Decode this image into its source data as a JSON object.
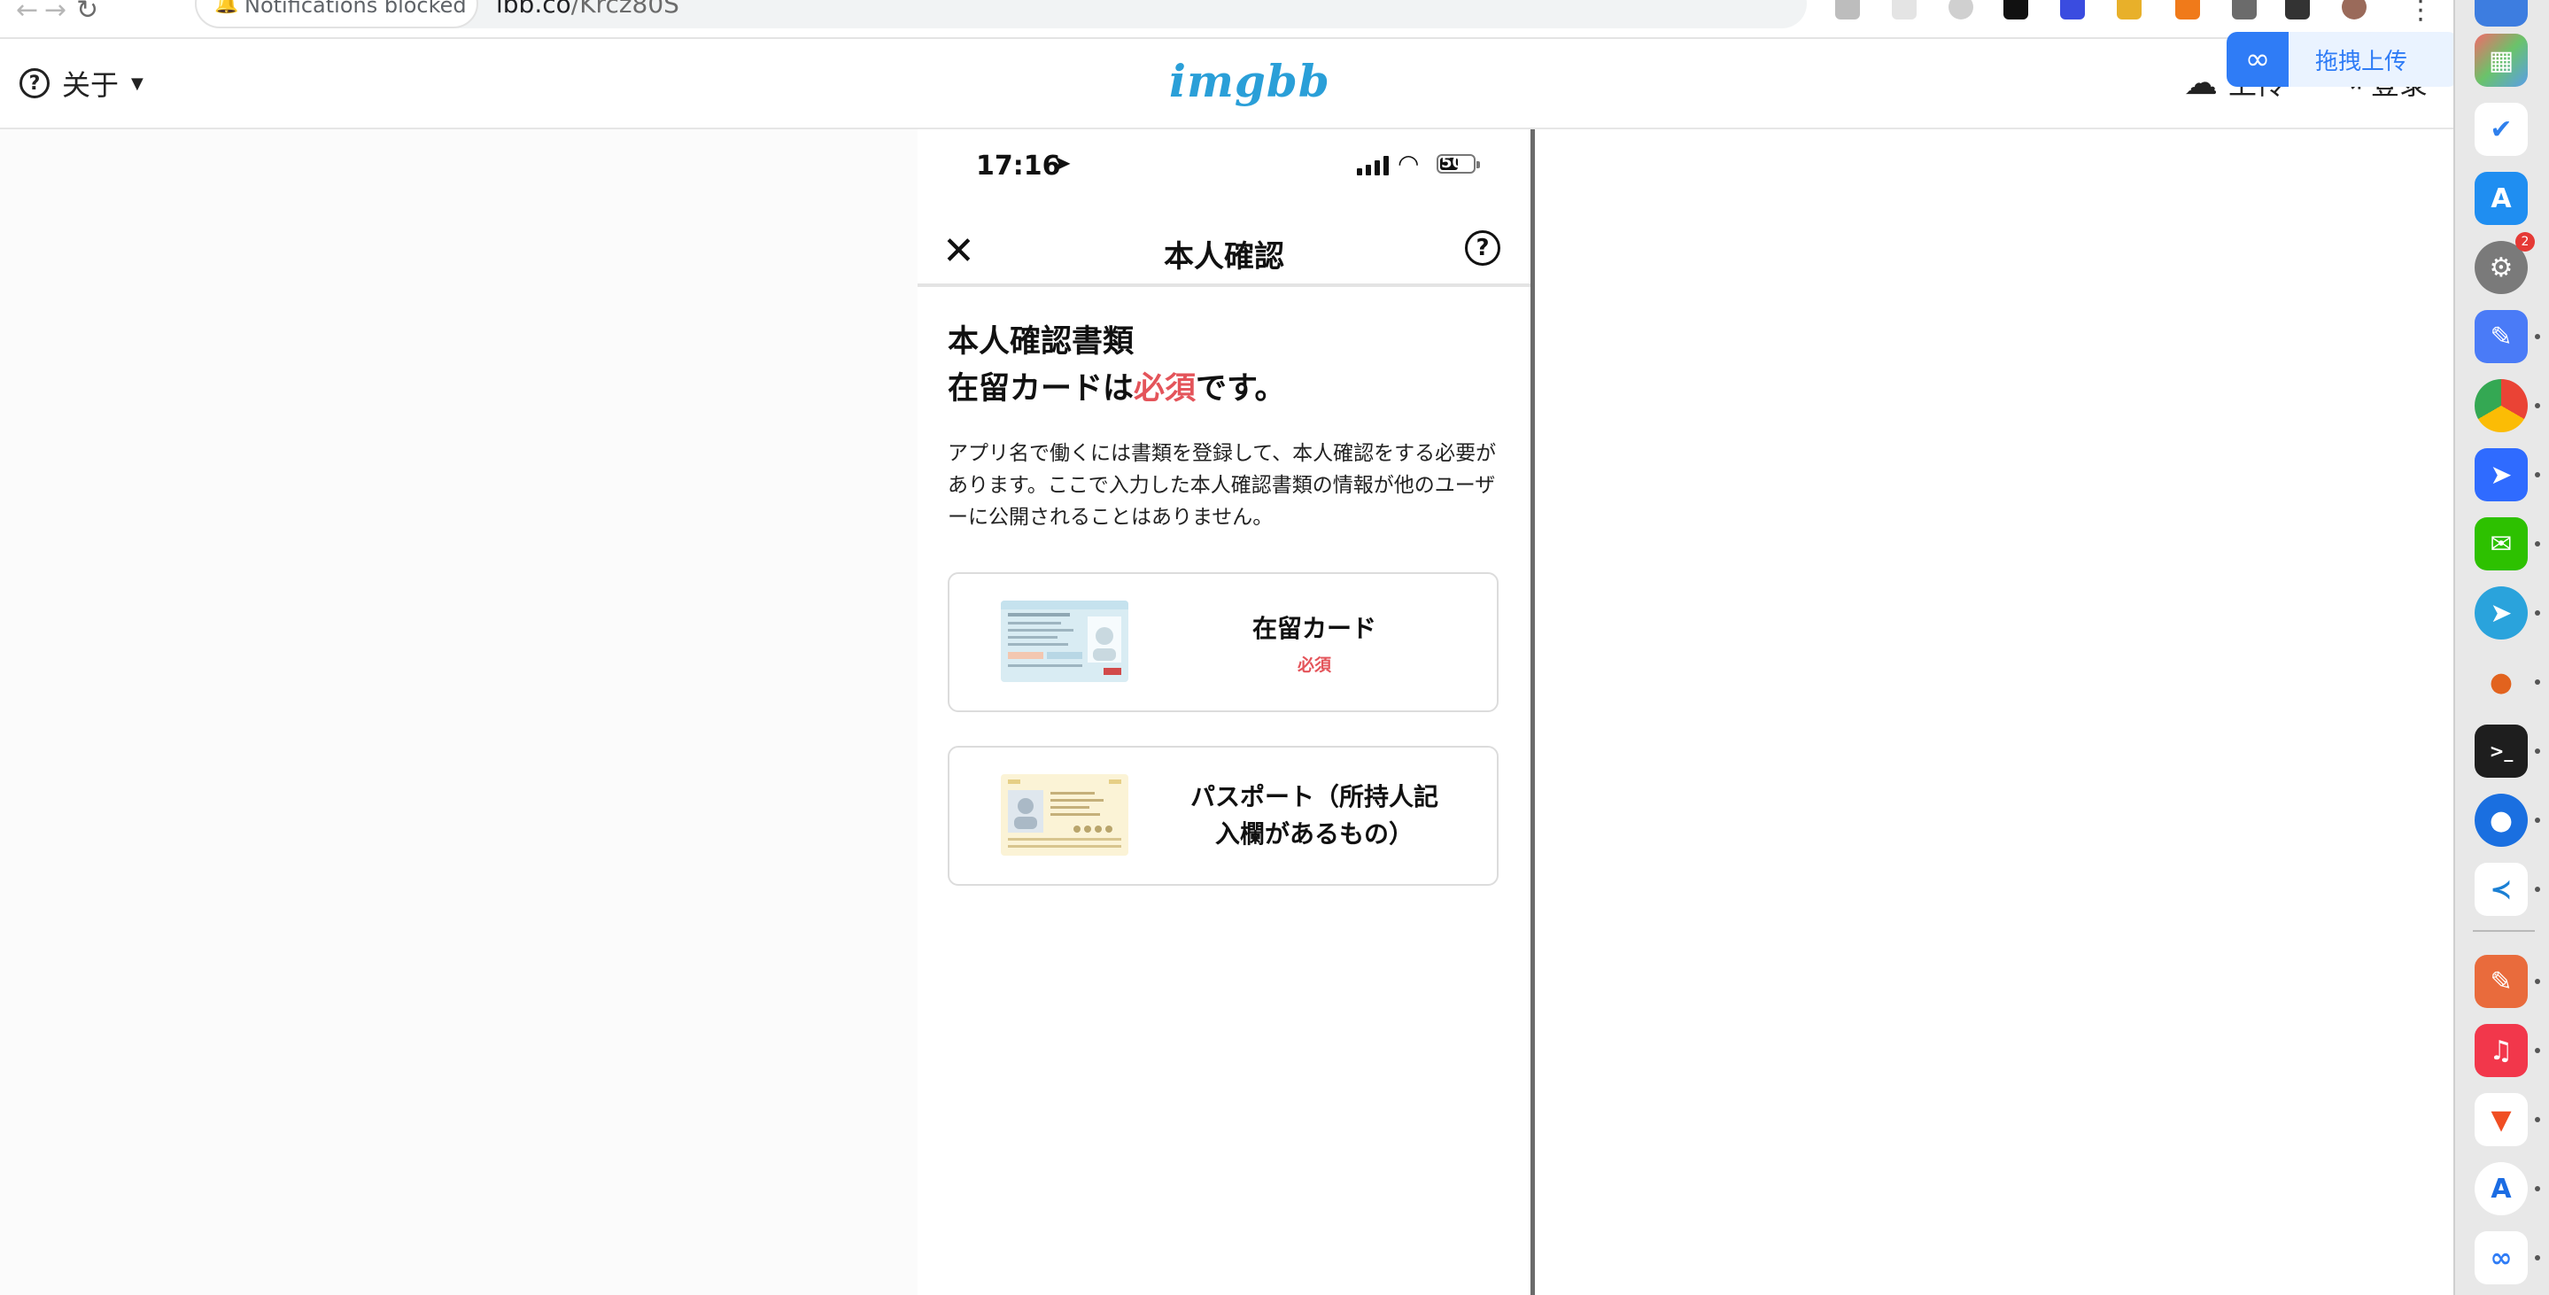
{
  "browser": {
    "notification_chip": "Notifications blocked",
    "url_domain": "ibb.co",
    "url_path": "/Krcz80S"
  },
  "site": {
    "about_label": "关于",
    "logo": "imgbb",
    "upload_label": "上传",
    "login_label": "登录"
  },
  "baidu_popup": {
    "label": "拖拽上传"
  },
  "phone": {
    "time": "17:16",
    "battery": "50",
    "title": "本人確認",
    "heading_line1": "本人確認書類",
    "heading_line2_prefix": "在留カードは",
    "heading_line2_required": "必須",
    "heading_line2_suffix": "です。",
    "description": "アプリ名で働くには書類を登録して、本人確認をする必要があります。ここで入力した本人確認書類の情報が他のユーザーに公開されることはありません。",
    "cards": [
      {
        "label": "在留カード",
        "badge": "必須"
      },
      {
        "label_line1": "パスポート（所持人記",
        "label_line2": "入欄があるもの）"
      }
    ]
  },
  "dock": {
    "settings_badge": "2",
    "apps": [
      "finder-app",
      "launchpad-app",
      "todo-app",
      "app-store",
      "system-settings",
      "notes-app",
      "chrome-browser",
      "lark-app",
      "wechat-app",
      "telegram-app",
      "vpn-app",
      "terminal-app",
      "maps-app",
      "vscode-app",
      "paw-app",
      "music-app",
      "brave-browser",
      "xcode-app",
      "baidu-netdisk-app"
    ]
  },
  "colors": {
    "accent_red": "#e4545a",
    "imgbb_blue": "#2a9fd8",
    "baidu_blue": "#2f7cf6"
  }
}
